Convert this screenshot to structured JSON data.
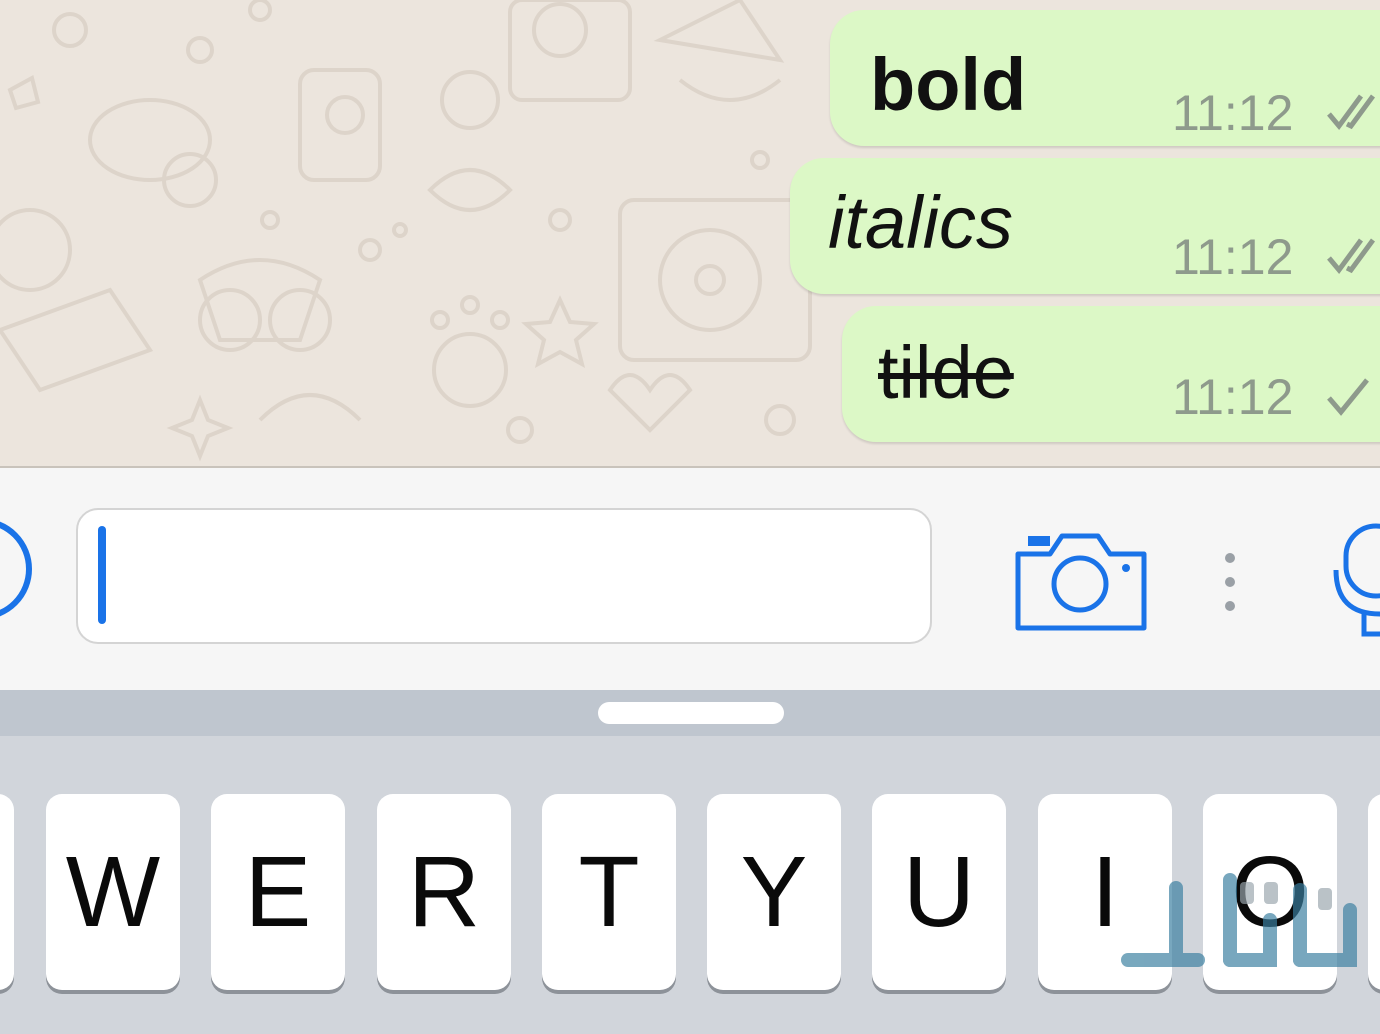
{
  "chat": {
    "messages": [
      {
        "text": "bold",
        "style": "bold",
        "time": "11:12",
        "status": "read"
      },
      {
        "text": "italics",
        "style": "italic",
        "time": "11:12",
        "status": "read"
      },
      {
        "text": "tilde",
        "style": "strikethrough",
        "time": "11:12",
        "status": "sent"
      }
    ]
  },
  "input_bar": {
    "message_value": "",
    "icons": [
      "plus-icon",
      "camera-icon",
      "more-icon",
      "microphone-icon"
    ]
  },
  "keyboard": {
    "row_keys": [
      "W",
      "E",
      "R",
      "T",
      "Y",
      "U",
      "I",
      "O"
    ]
  },
  "colors": {
    "bubble": "#dcf8c6",
    "wallpaper": "#ece5dd",
    "accent": "#1a73e8",
    "timestamp": "#8e9a8c",
    "keyboard": "#d1d5db"
  }
}
